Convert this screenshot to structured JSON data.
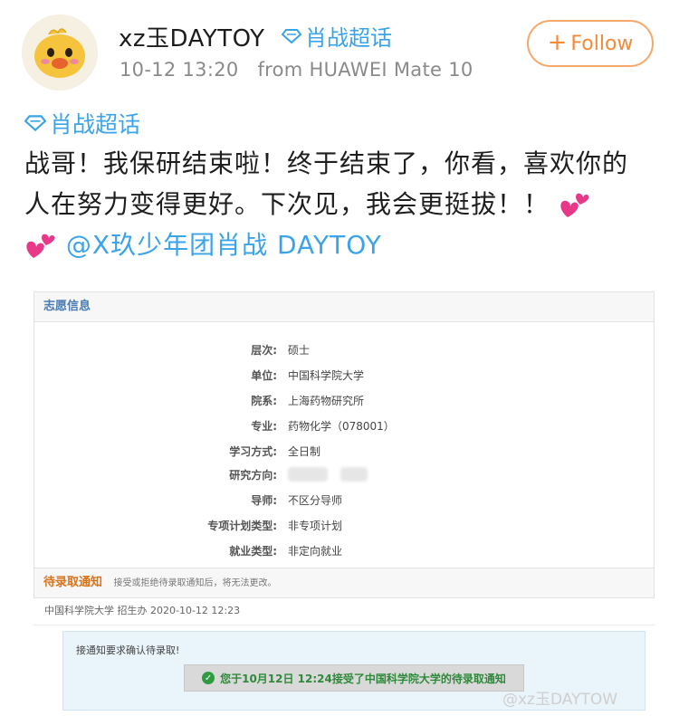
{
  "user": {
    "name": "xz玉DAYTOY",
    "super_topic": "肖战超话"
  },
  "meta": {
    "time": "10-12 13:20",
    "source": "from HUAWEI Mate 10"
  },
  "follow": {
    "label": "Follow"
  },
  "post": {
    "super_topic": "肖战超话",
    "text": "战哥！我保研结束啦！终于结束了，你看，喜欢你的人在努力变得更好。下次见，我会更挺拔！！",
    "mention": "@X玖少年团肖战 DAYTOY"
  },
  "screenshot": {
    "section1_title": "志愿信息",
    "rows": [
      {
        "label": "层次:",
        "value": "硕士"
      },
      {
        "label": "单位:",
        "value": "中国科学院大学"
      },
      {
        "label": "院系:",
        "value": "上海药物研究所"
      },
      {
        "label": "专业:",
        "value": "药物化学（078001）"
      },
      {
        "label": "学习方式:",
        "value": "全日制"
      },
      {
        "label": "研究方向:",
        "value": ""
      },
      {
        "label": "导师:",
        "value": "不区分导师"
      },
      {
        "label": "专项计划类型:",
        "value": "非专项计划"
      },
      {
        "label": "就业类型:",
        "value": "非定向就业"
      }
    ],
    "section2_title": "待录取通知",
    "section2_note": "接受或拒绝待录取通知后，将无法更改。",
    "notice_from": "中国科学院大学 招生办 2020-10-12 12:23",
    "notice_msg": "接通知要求确认待录取!",
    "accepted": "您于10月12日 12:24接受了中国科学院大学的待录取通知"
  },
  "watermark": "@xz玉DAYTOW",
  "colors": {
    "link": "#3aa3ea",
    "follow": "#f28a3a",
    "accept": "#2e8a3a",
    "header_blue": "#4a7bb0",
    "header_orange": "#d9731a"
  }
}
